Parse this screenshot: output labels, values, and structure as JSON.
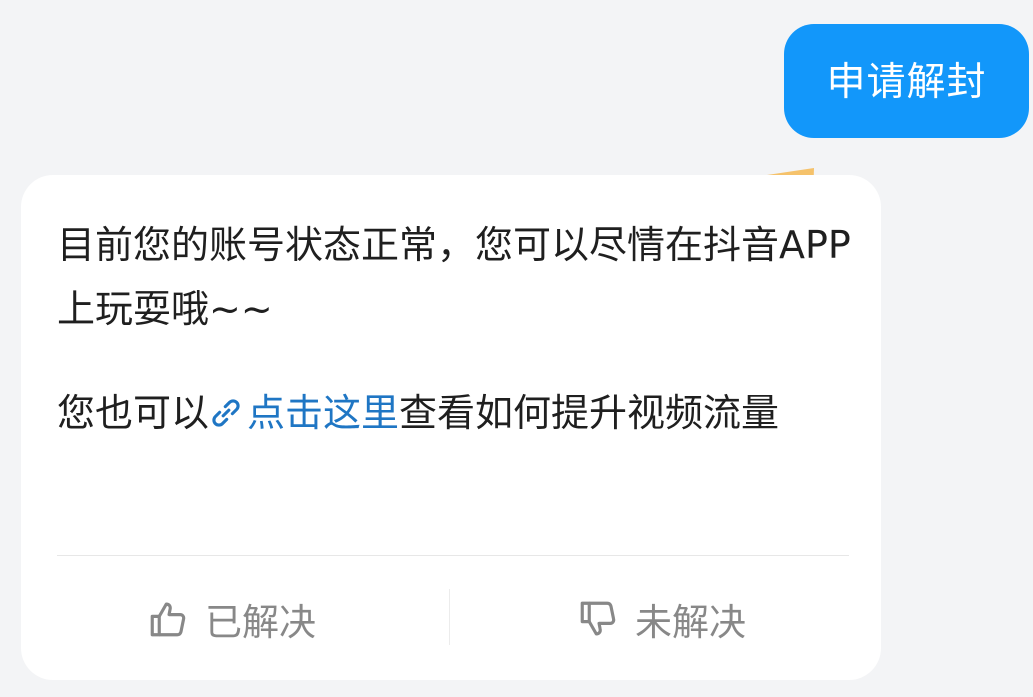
{
  "chat": {
    "user_message": "申请解封",
    "reply": {
      "paragraph_1": "目前您的账号状态正常，您可以尽情在抖音APP上玩耍哦~~",
      "paragraph_2_prefix": "您也可以",
      "link_label": "点击这里",
      "paragraph_2_suffix": "查看如何提升视频流量"
    },
    "feedback": {
      "resolved": "已解决",
      "unresolved": "未解决"
    }
  },
  "colors": {
    "user_bubble": "#1297fa",
    "link": "#1f76c4",
    "arrow": "#f5c26b",
    "feedback_text": "#888888",
    "background": "#f3f4f6"
  },
  "icons": {
    "link": "link-icon",
    "thumb_up": "thumb-up-icon",
    "thumb_down": "thumb-down-icon",
    "pointer": "pointer-arrow-icon"
  }
}
